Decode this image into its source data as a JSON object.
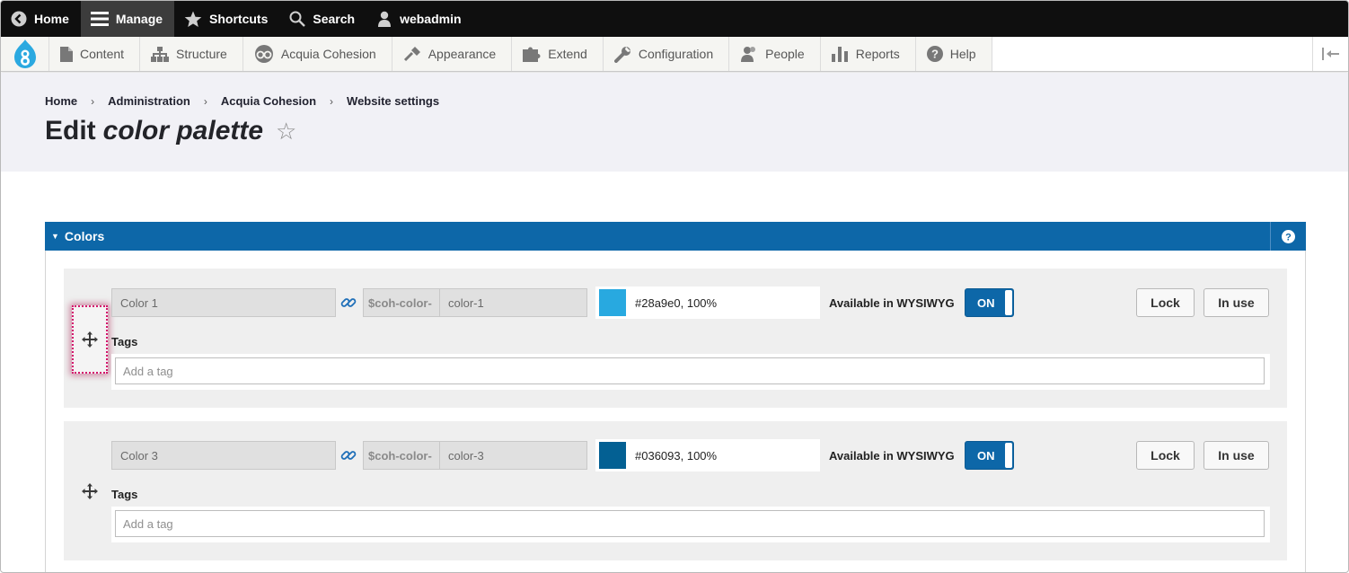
{
  "toolbar": {
    "items": [
      {
        "label": "Home",
        "icon": "back-circle-icon"
      },
      {
        "label": "Manage",
        "icon": "hamburger-icon"
      },
      {
        "label": "Shortcuts",
        "icon": "star-icon"
      },
      {
        "label": "Search",
        "icon": "search-icon"
      },
      {
        "label": "webadmin",
        "icon": "user-icon"
      }
    ]
  },
  "tray": {
    "items": [
      {
        "label": "Content",
        "icon": "document-icon"
      },
      {
        "label": "Structure",
        "icon": "sitemap-icon"
      },
      {
        "label": "Acquia Cohesion",
        "icon": "cohesion-icon"
      },
      {
        "label": "Appearance",
        "icon": "paintbrush-icon"
      },
      {
        "label": "Extend",
        "icon": "puzzle-icon"
      },
      {
        "label": "Configuration",
        "icon": "wrench-icon"
      },
      {
        "label": "People",
        "icon": "people-icon"
      },
      {
        "label": "Reports",
        "icon": "bar-chart-icon"
      },
      {
        "label": "Help",
        "icon": "help-circle-icon"
      }
    ]
  },
  "breadcrumb": [
    "Home",
    "Administration",
    "Acquia Cohesion",
    "Website settings"
  ],
  "page": {
    "title_prefix": "Edit",
    "title_emphasis": "color palette",
    "favorite_glyph": "☆"
  },
  "panel": {
    "title": "Colors",
    "help_icon": "help-circle-icon",
    "rows": [
      {
        "name": "Color 1",
        "var_prefix": "$coh-color-",
        "var_name": "color-1",
        "swatch": "#28a9e0",
        "color_text": "#28a9e0, 100%",
        "wysiwyg_label": "Available in WYSIWYG",
        "toggle": "ON",
        "lock": "Lock",
        "in_use": "In use",
        "tags_label": "Tags",
        "tags_placeholder": "Add a tag"
      },
      {
        "name": "Color 3",
        "var_prefix": "$coh-color-",
        "var_name": "color-3",
        "swatch": "#036093",
        "color_text": "#036093, 100%",
        "wysiwyg_label": "Available in WYSIWYG",
        "toggle": "ON",
        "lock": "Lock",
        "in_use": "In use",
        "tags_label": "Tags",
        "tags_placeholder": "Add a tag"
      }
    ]
  },
  "colors": {
    "toolbar_bg": "#0f0f0f",
    "panel_blue": "#0d67a8",
    "drag_highlight": "#d4156c"
  }
}
